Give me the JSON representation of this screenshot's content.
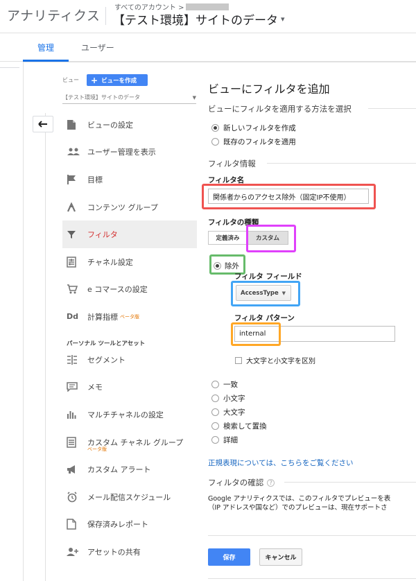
{
  "header": {
    "app_title": "アナリティクス",
    "account_label": "すべてのアカウント >",
    "property_title": "【テスト環境】サイトのデータ",
    "caret": "▾"
  },
  "tabs": [
    {
      "label": "管理",
      "active": true
    },
    {
      "label": "ユーザー",
      "active": false
    }
  ],
  "view": {
    "label": "ビュー",
    "create_button": "ビューを作成",
    "selected": "【テスト環境】サイトのデータ"
  },
  "menu": {
    "items": [
      {
        "label": "ビューの設定",
        "icon": "document-icon"
      },
      {
        "label": "ユーザー管理を表示",
        "icon": "people-icon"
      },
      {
        "label": "目標",
        "icon": "flag-icon"
      },
      {
        "label": "コンテンツ グループ",
        "icon": "content-grouping-icon"
      },
      {
        "label": "フィルタ",
        "icon": "filter-icon",
        "active": true
      },
      {
        "label": "チャネル設定",
        "icon": "channel-settings-icon"
      },
      {
        "label": "e コマースの設定",
        "icon": "cart-icon"
      },
      {
        "label": "計算指標",
        "icon": "dd-icon",
        "beta": "ベータ版"
      }
    ],
    "personal_heading": "パーソナル ツールとアセット",
    "personal_items": [
      {
        "label": "セグメント",
        "icon": "segment-icon"
      },
      {
        "label": "メモ",
        "icon": "memo-icon"
      },
      {
        "label": "マルチチャネルの設定",
        "icon": "bar-chart-icon"
      },
      {
        "label": "カスタム チャネル グループ",
        "icon": "custom-channel-icon",
        "beta": "ベータ版"
      },
      {
        "label": "カスタム アラート",
        "icon": "megaphone-icon"
      },
      {
        "label": "メール配信スケジュール",
        "icon": "alarm-clock-icon"
      },
      {
        "label": "保存済みレポート",
        "icon": "saved-report-icon"
      },
      {
        "label": "アセットの共有",
        "icon": "share-person-icon"
      }
    ]
  },
  "main": {
    "title": "ビューにフィルタを追加",
    "apply_heading": "ビューにフィルタを適用する方法を選択",
    "apply_options": [
      "新しいフィルタを作成",
      "既存のフィルタを適用"
    ],
    "info_heading": "フィルタ情報",
    "name_label": "フィルタ名",
    "name_value": "関係者からのアクセス除外（固定IP不使用）",
    "type_label": "フィルタの種類",
    "type_predefined": "定義済み",
    "type_custom": "カスタム",
    "exclude_label": "除外",
    "field_label": "フィルタ フィールド",
    "field_value": "AccessType",
    "pattern_label": "フィルタ パターン",
    "pattern_value": "internal",
    "case_label": "大文字と小文字を区別",
    "other_options": [
      "一致",
      "小文字",
      "大文字",
      "検索して置換",
      "詳細"
    ],
    "regex_link": "正規表現については、こちらをご覧ください",
    "confirm_heading": "フィルタの確認",
    "confirm_line1": "Google アナリティクスでは、このフィルタでプレビューを表",
    "confirm_line2": "（IP アドレスや国など）でのプレビューは、現在サポートさ",
    "save": "保存",
    "cancel": "キャンセル"
  },
  "highlights": {
    "name_box": "#ef5350",
    "custom_box": "#e040fb",
    "exclude_box": "#66bb6a",
    "field_box": "#42a5f5",
    "pattern_box": "#ffa726"
  }
}
